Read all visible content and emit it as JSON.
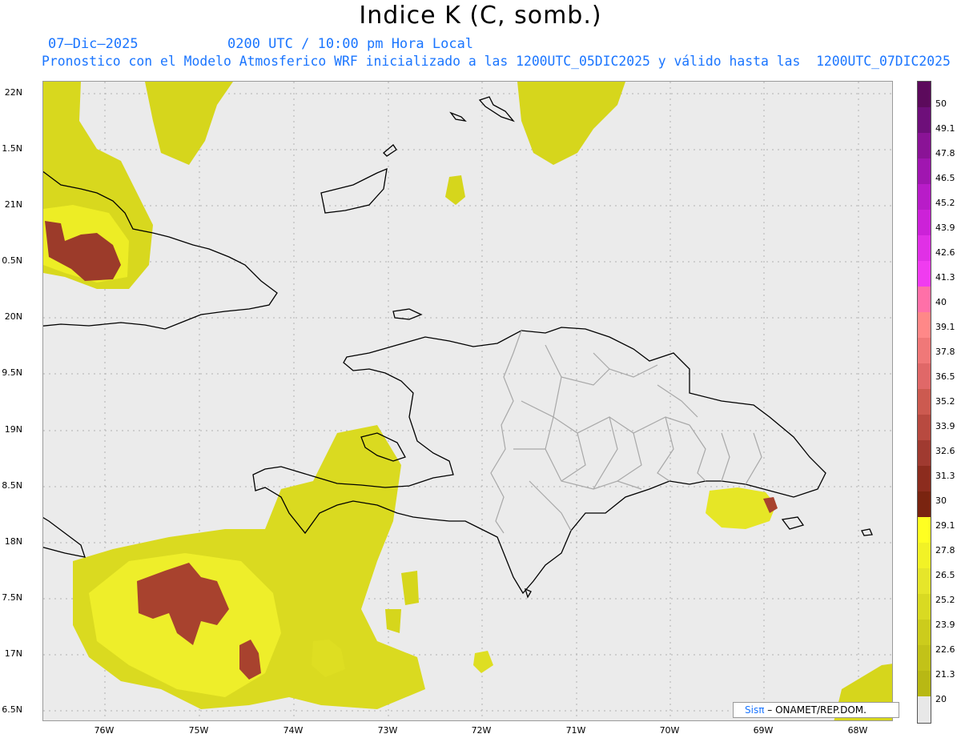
{
  "title": "Indice K (C, somb.)",
  "date": "07–Dic–2025",
  "time": "0200 UTC / 10:00 pm Hora Local",
  "description": "Pronostico con el Modelo Atmosferico WRF inicializado a las 1200UTC_05DIC2025 y válido hasta las  1200UTC_07DIC2025",
  "lat_labels": [
    "22N",
    "1.5N",
    "21N",
    "0.5N",
    "20N",
    "9.5N",
    "19N",
    "8.5N",
    "18N",
    "7.5N",
    "17N",
    "6.5N"
  ],
  "lon_labels": [
    "76W",
    "75W",
    "74W",
    "73W",
    "72W",
    "71W",
    "70W",
    "69W",
    "68W"
  ],
  "colorbar": {
    "labels": [
      "50",
      "49.1",
      "47.8",
      "46.5",
      "45.2",
      "43.9",
      "42.6",
      "41.3",
      "40",
      "39.1",
      "37.8",
      "36.5",
      "35.2",
      "33.9",
      "32.6",
      "31.3",
      "30",
      "29.1",
      "27.8",
      "26.5",
      "25.2",
      "23.9",
      "22.6",
      "21.3",
      "20"
    ],
    "colors": [
      "#5c0a5c",
      "#6e0f7a",
      "#8a1396",
      "#a016b0",
      "#b81cc8",
      "#cc22d8",
      "#e030e6",
      "#f03cf0",
      "#ff70a8",
      "#ff8888",
      "#f07878",
      "#e06868",
      "#cc5a50",
      "#b84a40",
      "#a03a30",
      "#8c2c1e",
      "#7a2410",
      "#ffff22",
      "#f2f226",
      "#e6e62a",
      "#d9da22",
      "#cccc1c",
      "#c2c218",
      "#b8b814",
      "#e8e8e8"
    ]
  },
  "credit": {
    "brand": "Sisπ",
    "org": "– ONAMET/REP.DOM."
  }
}
